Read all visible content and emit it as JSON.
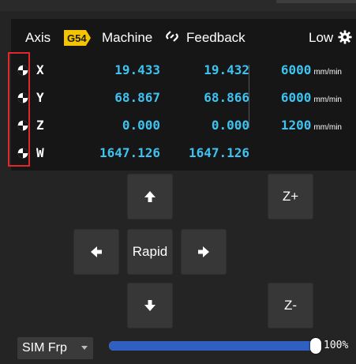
{
  "header": {
    "axis_label": "Axis",
    "wcs_badge": "G54",
    "machine_label": "Machine",
    "feedback_label": "Feedback",
    "speed_mode": "Low"
  },
  "axes": [
    {
      "axis": "X",
      "work_pos": "19.433",
      "machine_pos": "19.432",
      "feedrate": "6000",
      "unit": "mm/min"
    },
    {
      "axis": "Y",
      "work_pos": "68.867",
      "machine_pos": "68.866",
      "feedrate": "6000",
      "unit": "mm/min"
    },
    {
      "axis": "Z",
      "work_pos": "0.000",
      "machine_pos": "0.000",
      "feedrate": "1200",
      "unit": "mm/min"
    },
    {
      "axis": "W",
      "work_pos": "1647.126",
      "machine_pos": "1647.126",
      "feedrate": "",
      "unit": ""
    }
  ],
  "jog": {
    "rapid_label": "Rapid",
    "z_plus_label": "Z+",
    "z_minus_label": "Z-"
  },
  "footer": {
    "mode_select": "SIM Frp",
    "feed_override_percent": 100,
    "feed_override_label": "100%"
  },
  "colors": {
    "value_text": "#3ec3f0",
    "wcs_badge": "#f5c400",
    "highlight_border": "#e0282c",
    "slider_fill": "#2f5fc1"
  }
}
